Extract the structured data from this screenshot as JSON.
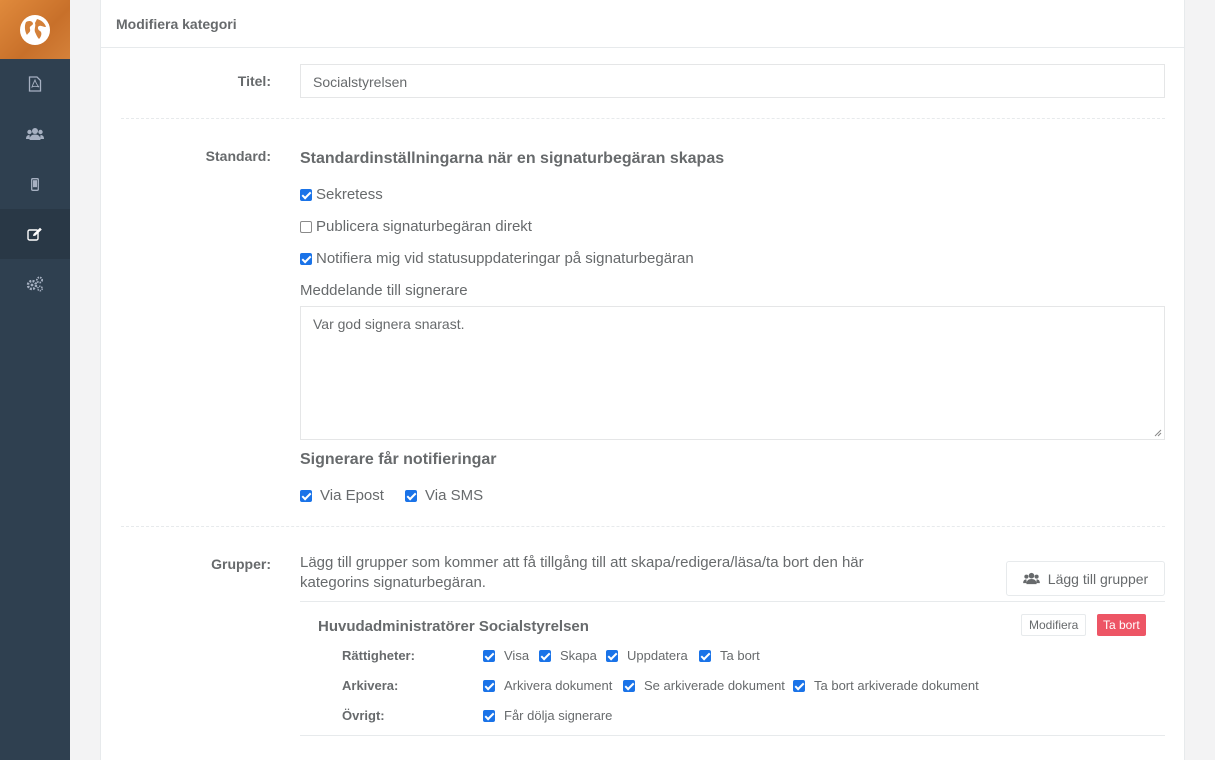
{
  "sidebar": {
    "items": [
      {
        "icon": "pdf-file-icon"
      },
      {
        "icon": "users-icon"
      },
      {
        "icon": "mobile-icon"
      },
      {
        "icon": "edit-icon",
        "active": true
      },
      {
        "icon": "cogs-icon"
      }
    ]
  },
  "panel": {
    "title": "Modifiera kategori"
  },
  "form": {
    "title_label": "Titel:",
    "title_value": "Socialstyrelsen",
    "standard_label": "Standard:",
    "standard_heading": "Standardinställningarna när en signaturbegäran skapas",
    "options": [
      {
        "label": "Sekretess",
        "checked": true
      },
      {
        "label": "Publicera signaturbegäran direkt",
        "checked": false
      },
      {
        "label": "Notifiera mig vid statusuppdateringar på signaturbegäran",
        "checked": true
      }
    ],
    "message_label": "Meddelande till signerare",
    "message_value": "Var god signera snarast.",
    "notify_heading": "Signerare får notifieringar",
    "notify_options": [
      {
        "label": "Via Epost",
        "checked": true
      },
      {
        "label": "Via SMS",
        "checked": true
      }
    ],
    "groups_label": "Grupper:",
    "groups_description": "Lägg till grupper som kommer att få tillgång till att skapa/redigera/läsa/ta bort den här kategorins signaturbegäran.",
    "add_groups_button": "Lägg till grupper"
  },
  "group": {
    "name": "Huvudadministratörer Socialstyrelsen",
    "modify_button": "Modifiera",
    "delete_button": "Ta bort",
    "rights_label": "Rättigheter:",
    "rights": [
      "Visa",
      "Skapa",
      "Uppdatera",
      "Ta bort"
    ],
    "archive_label": "Arkivera:",
    "archive": [
      "Arkivera dokument",
      "Se arkiverade dokument",
      "Ta bort arkiverade dokument"
    ],
    "other_label": "Övrigt:",
    "other": [
      "Får dölja signerare"
    ]
  },
  "colors": {
    "sidebar": "#2f4050",
    "accent_checkbox": "#1a73e8",
    "danger": "#ed5565",
    "logo": "#d4813a"
  }
}
